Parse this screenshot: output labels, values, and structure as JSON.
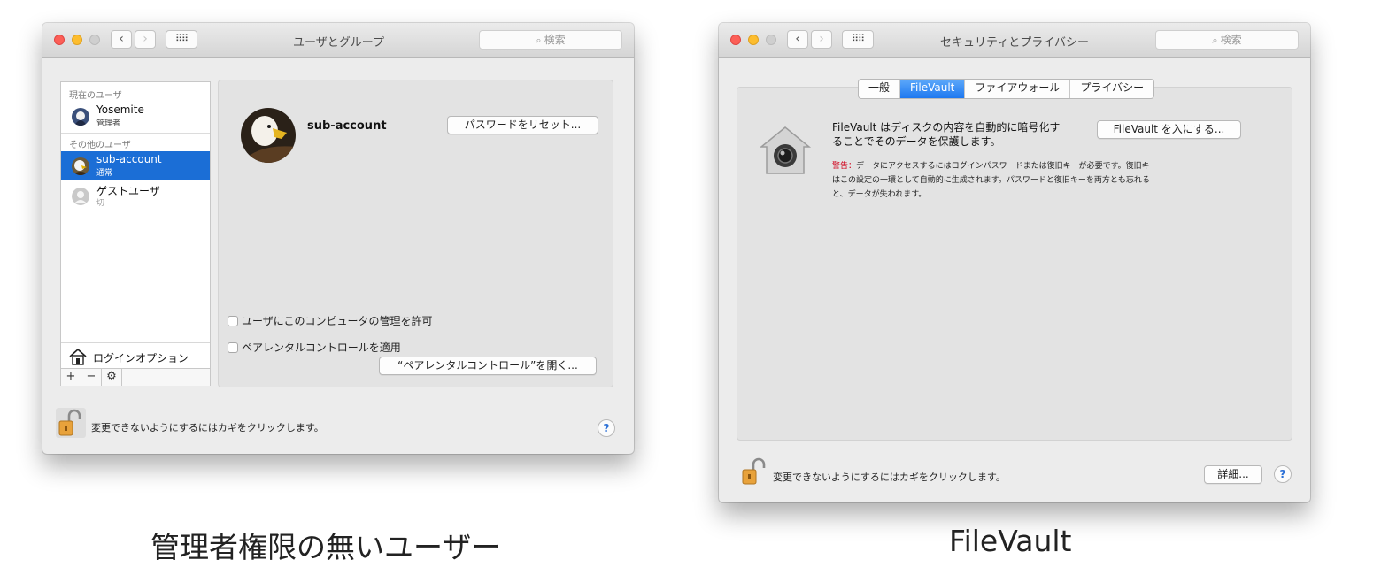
{
  "left_window": {
    "title": "ユーザとグループ",
    "search_placeholder": "検索",
    "sections": {
      "current_users": "現在のユーザ",
      "other_users": "その他のユーザ"
    },
    "users": [
      {
        "name": "Yosemite",
        "role": "管理者"
      },
      {
        "name": "sub-account",
        "role": "通常",
        "selected": true
      },
      {
        "name": "ゲストユーザ",
        "role": "切"
      }
    ],
    "login_options": "ログインオプション",
    "bottom_buttons": [
      "+",
      "−",
      "⚙"
    ],
    "detail": {
      "account_name": "sub-account",
      "reset_password_button": "パスワードをリセット...",
      "allow_admin_checkbox": "ユーザにこのコンピュータの管理を許可",
      "allow_admin_checked": false,
      "parental_checkbox": "ペアレンタルコントロールを適用",
      "parental_checked": false,
      "open_parental_button": "“ペアレンタルコントロール”を開く..."
    },
    "lock_text": "変更できないようにするにはカギをクリックします。",
    "help": "?"
  },
  "right_window": {
    "title": "セキュリティとプライバシー",
    "search_placeholder": "検索",
    "tabs": [
      "一般",
      "FileVault",
      "ファイアウォール",
      "プライバシー"
    ],
    "active_tab": "FileVault",
    "description_line1": "FileVault はディスクの内容を自動的に暗号化す",
    "description_line2": "ることでそのデータを保護します。",
    "turn_on_button": "FileVault を入にする...",
    "warning_label": "警告：",
    "warning_line1": "データにアクセスするにはログインパスワードまたは復旧キーが必要です。復旧キー",
    "warning_line2": "はこの設定の一環として自動的に生成されます。パスワードと復旧キーを両方とも忘れる",
    "warning_line3": "と、データが失われます。",
    "lock_text": "変更できないようにするにはカギをクリックします。",
    "details_button": "詳細...",
    "help": "?"
  },
  "captions": {
    "left": "管理者権限の無いユーザー",
    "right": "FileVault"
  },
  "colors": {
    "selection": "#1b6ed6",
    "warning": "#d0021b",
    "tab_active": "#1e78f0",
    "close": "#fc5f57",
    "minimize": "#fdbd2e"
  }
}
